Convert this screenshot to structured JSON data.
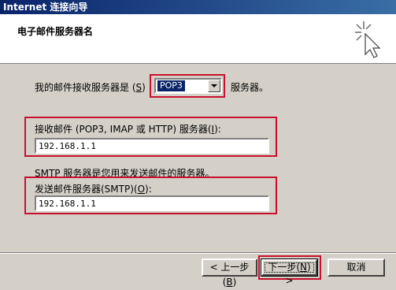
{
  "window": {
    "title": "Internet 连接向导"
  },
  "header": {
    "title": "电子邮件服务器名",
    "icon": "wizard-sparkle-cursor-icon"
  },
  "incoming": {
    "label_prefix": "我的邮件接收服务器是 (",
    "label_key": "S",
    "label_suffix": ")",
    "selected": "POP3",
    "suffix": "服务器。"
  },
  "incoming_server": {
    "label_prefix": "接收邮件 (POP3, IMAP 或 HTTP) 服务器(",
    "label_key": "I",
    "label_suffix": "):",
    "value": "192.168.1.1"
  },
  "smtp_note": "SMTP 服务器是您用来发送邮件的服务器。",
  "outgoing_server": {
    "label_prefix": "发送邮件服务器(SMTP)(",
    "label_key": "O",
    "label_suffix": "):",
    "value": "192.168.1.1"
  },
  "buttons": {
    "back": {
      "prefix": "< 上一步(",
      "key": "B",
      "suffix": ")"
    },
    "next": {
      "prefix": "下一步(",
      "key": "N",
      "suffix": ") >"
    },
    "cancel": "取消"
  },
  "colors": {
    "highlight_box": "#c8102e",
    "title_bar": "#0a246a"
  }
}
